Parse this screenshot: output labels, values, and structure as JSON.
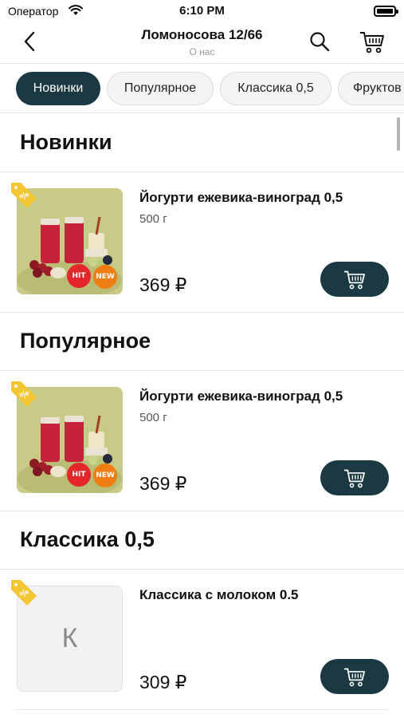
{
  "status_bar": {
    "carrier": "Оператор",
    "time": "6:10 PM"
  },
  "header": {
    "title": "Ломоносова 12/66",
    "subtitle": "О нас"
  },
  "categories": [
    "Новинки",
    "Популярное",
    "Классика 0,5",
    "Фруктов"
  ],
  "sections": [
    {
      "title": "Новинки",
      "product": {
        "name": "Йогурти ежевика-виноград 0,5",
        "weight": "500 г",
        "price": "369 ₽",
        "badges": [
          "HIT",
          "NEW"
        ]
      }
    },
    {
      "title": "Популярное",
      "product": {
        "name": "Йогурти ежевика-виноград 0,5",
        "weight": "500 г",
        "price": "369 ₽",
        "badges": [
          "HIT",
          "NEW"
        ]
      }
    },
    {
      "title": "Классика 0,5",
      "product": {
        "name": "Классика с молоком 0.5",
        "weight": "",
        "price": "309 ₽",
        "placeholder_letter": "К"
      }
    }
  ],
  "colors": {
    "accent": "#1b3943",
    "tag": "#f3c633",
    "hit": "#e2262b",
    "new": "#ef7d12"
  },
  "icons": {
    "back": "chevron-left-icon",
    "search": "search-icon",
    "cart": "cart-icon",
    "discount": "percent-tag-icon"
  }
}
